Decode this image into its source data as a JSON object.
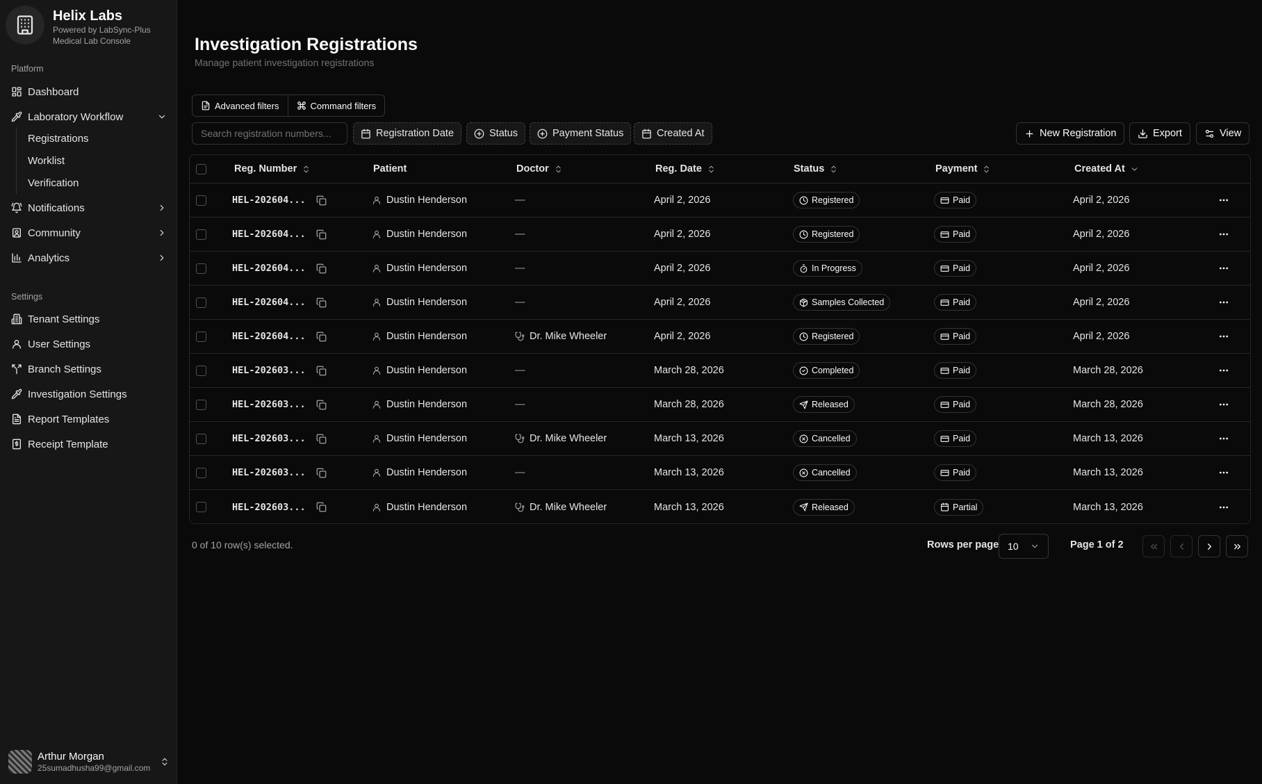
{
  "brand": {
    "name": "Helix Labs",
    "sub1": "Powered by LabSync-Plus",
    "sub2": "Medical Lab Console"
  },
  "sidebar": {
    "platform_label": "Platform",
    "settings_label": "Settings",
    "platform_items": [
      {
        "label": "Dashboard",
        "icon": "dashboard-icon"
      },
      {
        "label": "Laboratory Workflow",
        "icon": "pipette-icon",
        "expanded": true
      },
      {
        "label": "Notifications",
        "icon": "bell-icon"
      },
      {
        "label": "Community",
        "icon": "community-icon"
      },
      {
        "label": "Analytics",
        "icon": "chart-icon"
      }
    ],
    "workflow_sub": [
      "Registrations",
      "Worklist",
      "Verification"
    ],
    "settings_items": [
      {
        "label": "Tenant Settings",
        "icon": "building-icon"
      },
      {
        "label": "User Settings",
        "icon": "user-icon"
      },
      {
        "label": "Branch Settings",
        "icon": "branch-icon"
      },
      {
        "label": "Investigation Settings",
        "icon": "pipette-icon"
      },
      {
        "label": "Report Templates",
        "icon": "file-icon"
      },
      {
        "label": "Receipt Template",
        "icon": "receipt-icon"
      }
    ]
  },
  "user": {
    "name": "Arthur Morgan",
    "email": "25sumadhusha99@gmail.com"
  },
  "page": {
    "title": "Investigation Registrations",
    "subtitle": "Manage patient investigation registrations"
  },
  "filters": {
    "advanced": "Advanced filters",
    "command": "Command filters",
    "search_placeholder": "Search registration numbers...",
    "chips": [
      "Registration Date",
      "Status",
      "Payment Status",
      "Created At"
    ]
  },
  "actions": {
    "new": "New Registration",
    "export": "Export",
    "view": "View"
  },
  "table": {
    "columns": [
      "Reg. Number",
      "Patient",
      "Doctor",
      "Reg. Date",
      "Status",
      "Payment",
      "Created At"
    ],
    "rows": [
      {
        "reg": "HEL-202604...",
        "patient": "Dustin Henderson",
        "doctor": "—",
        "date": "April 2, 2026",
        "status": "Registered",
        "status_icon": "clock-icon",
        "payment": "Paid",
        "payment_icon": "card-icon",
        "created": "April 2, 2026"
      },
      {
        "reg": "HEL-202604...",
        "patient": "Dustin Henderson",
        "doctor": "—",
        "date": "April 2, 2026",
        "status": "Registered",
        "status_icon": "clock-icon",
        "payment": "Paid",
        "payment_icon": "card-icon",
        "created": "April 2, 2026"
      },
      {
        "reg": "HEL-202604...",
        "patient": "Dustin Henderson",
        "doctor": "—",
        "date": "April 2, 2026",
        "status": "In Progress",
        "status_icon": "timer-icon",
        "payment": "Paid",
        "payment_icon": "card-icon",
        "created": "April 2, 2026"
      },
      {
        "reg": "HEL-202604...",
        "patient": "Dustin Henderson",
        "doctor": "—",
        "date": "April 2, 2026",
        "status": "Samples Collected",
        "status_icon": "package-icon",
        "payment": "Paid",
        "payment_icon": "card-icon",
        "created": "April 2, 2026"
      },
      {
        "reg": "HEL-202604...",
        "patient": "Dustin Henderson",
        "doctor": "Dr. Mike Wheeler",
        "date": "April 2, 2026",
        "status": "Registered",
        "status_icon": "clock-icon",
        "payment": "Paid",
        "payment_icon": "card-icon",
        "created": "April 2, 2026"
      },
      {
        "reg": "HEL-202603...",
        "patient": "Dustin Henderson",
        "doctor": "—",
        "date": "March 28, 2026",
        "status": "Completed",
        "status_icon": "check-circle-icon",
        "payment": "Paid",
        "payment_icon": "card-icon",
        "created": "March 28, 2026"
      },
      {
        "reg": "HEL-202603...",
        "patient": "Dustin Henderson",
        "doctor": "—",
        "date": "March 28, 2026",
        "status": "Released",
        "status_icon": "send-icon",
        "payment": "Paid",
        "payment_icon": "card-icon",
        "created": "March 28, 2026"
      },
      {
        "reg": "HEL-202603...",
        "patient": "Dustin Henderson",
        "doctor": "Dr. Mike Wheeler",
        "date": "March 13, 2026",
        "status": "Cancelled",
        "status_icon": "x-circle-icon",
        "payment": "Paid",
        "payment_icon": "card-icon",
        "created": "March 13, 2026"
      },
      {
        "reg": "HEL-202603...",
        "patient": "Dustin Henderson",
        "doctor": "—",
        "date": "March 13, 2026",
        "status": "Cancelled",
        "status_icon": "x-circle-icon",
        "payment": "Paid",
        "payment_icon": "card-icon",
        "created": "March 13, 2026"
      },
      {
        "reg": "HEL-202603...",
        "patient": "Dustin Henderson",
        "doctor": "Dr. Mike Wheeler",
        "date": "March 13, 2026",
        "status": "Released",
        "status_icon": "send-icon",
        "payment": "Partial",
        "payment_icon": "calendar-icon",
        "created": "March 13, 2026"
      }
    ]
  },
  "footer": {
    "selected": "0 of 10 row(s) selected.",
    "rows_per_page_label": "Rows per page",
    "rows_per_page_value": "10",
    "page_info": "Page 1 of 2"
  }
}
